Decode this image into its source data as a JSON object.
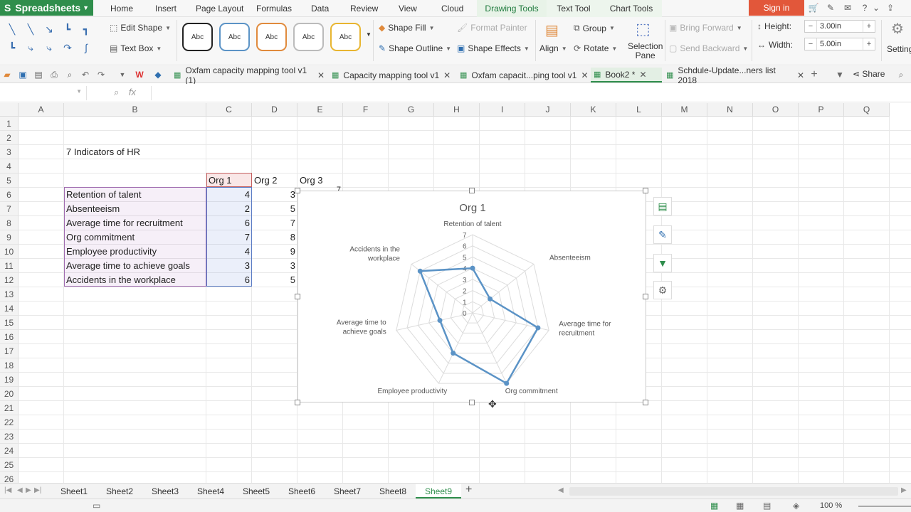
{
  "app": {
    "name": "Spreadsheets"
  },
  "menu": {
    "items": [
      "Home",
      "Insert",
      "Page Layout",
      "Formulas",
      "Data",
      "Review",
      "View",
      "Cloud",
      "Drawing Tools",
      "Text Tool",
      "Chart Tools"
    ],
    "active": "Drawing Tools",
    "signin": "Sign in"
  },
  "ribbon": {
    "edit_shape": "Edit Shape",
    "text_box": "Text Box",
    "style_label": "Abc",
    "shape_fill": "Shape Fill",
    "shape_outline": "Shape Outline",
    "format_painter": "Format Painter",
    "shape_effects": "Shape Effects",
    "align": "Align",
    "group": "Group",
    "rotate": "Rotate",
    "selection_pane_1": "Selection",
    "selection_pane_2": "Pane",
    "bring_forward": "Bring Forward",
    "send_backward": "Send Backward",
    "height_label": "Height:",
    "height_value": "3.00in",
    "width_label": "Width:",
    "width_value": "5.00in",
    "settings": "Setting"
  },
  "tabs": [
    {
      "label": "Oxfam capacity mapping tool v1 (1)"
    },
    {
      "label": "Capacity mapping tool v1"
    },
    {
      "label": "Oxfam capacit...ping tool v1"
    },
    {
      "label": "Book2 *"
    },
    {
      "label": "Schdule-Update...ners list 2018"
    }
  ],
  "share": "Share",
  "formula": {
    "fx": "fx"
  },
  "grid": {
    "columns": [
      "A",
      "B",
      "C",
      "D",
      "E",
      "F",
      "G",
      "H",
      "I",
      "J",
      "K",
      "L",
      "M",
      "N",
      "O",
      "P",
      "Q"
    ],
    "rows": [
      "1",
      "2",
      "3",
      "4",
      "5",
      "6",
      "7",
      "8",
      "9",
      "10",
      "11",
      "12",
      "13",
      "14",
      "15",
      "16",
      "17",
      "18",
      "19",
      "20",
      "21",
      "22",
      "23",
      "24",
      "25",
      "26"
    ],
    "title": "7 Indicators of HR",
    "headers": [
      "Org 1",
      "Org 2",
      "Org 3"
    ],
    "labels": [
      "Retention of talent",
      "Absenteeism",
      "Average time for recruitment",
      "Org commitment",
      "Employee productivity",
      "Average time to achieve goals",
      "Accidents in the workplace"
    ],
    "org1": [
      "4",
      "2",
      "6",
      "7",
      "4",
      "3",
      "6"
    ],
    "org2": [
      "3",
      "5",
      "7",
      "8",
      "9",
      "3",
      "5"
    ],
    "e6_partial": "7"
  },
  "chart_data": {
    "type": "radar",
    "title": "Org 1",
    "categories": [
      "Retention of talent",
      "Absenteeism",
      "Average time for recruitment",
      "Org commitment",
      "Employee productivity",
      "Average time to achieve goals",
      "Accidents in the workplace"
    ],
    "category_display": [
      [
        "Retention of talent"
      ],
      [
        "Absenteeism"
      ],
      [
        "Average time for",
        "recruitment"
      ],
      [
        "Org commitment"
      ],
      [
        "Employee productivity"
      ],
      [
        "Average time to",
        "achieve goals"
      ],
      [
        "Accidents in the",
        "workplace"
      ]
    ],
    "values": [
      4,
      2,
      6,
      7,
      4,
      3,
      6
    ],
    "rlim": [
      0,
      7
    ],
    "ticks": [
      "0",
      "1",
      "2",
      "3",
      "4",
      "5",
      "6",
      "7"
    ],
    "color": "#5b93c6",
    "legend": "none"
  },
  "sheets": [
    "Sheet1",
    "Sheet2",
    "Sheet3",
    "Sheet4",
    "Sheet5",
    "Sheet6",
    "Sheet7",
    "Sheet8",
    "Sheet9"
  ],
  "active_sheet": "Sheet9",
  "zoom": "100 %",
  "colors": {
    "accent": "#2f8e4c",
    "signin": "#e2573a",
    "series": "#5b93c6"
  }
}
